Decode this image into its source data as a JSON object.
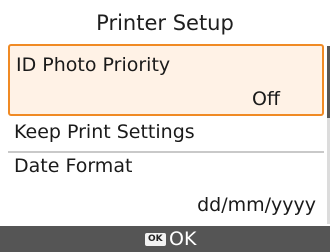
{
  "screen": {
    "title": "Printer Setup"
  },
  "menu": {
    "items": [
      {
        "label": "ID Photo Priority",
        "value": "Off",
        "selected": true
      },
      {
        "label": "Keep Print Settings"
      },
      {
        "label": "Date Format",
        "value": "dd/mm/yyyy"
      }
    ]
  },
  "footer": {
    "key_icon_text": "OK",
    "action_label": "OK"
  },
  "colors": {
    "highlight_border": "#f08a24",
    "highlight_fill": "#fff2e6",
    "footer_bg": "#555555"
  }
}
